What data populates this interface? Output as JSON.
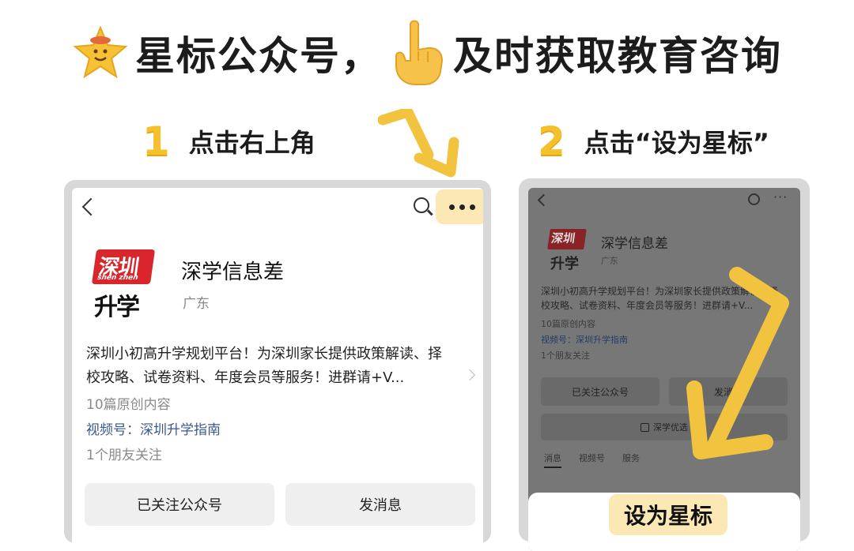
{
  "header": {
    "title": "星标公众号，",
    "title_tail": "及时获取教育咨询"
  },
  "step1": {
    "number": "1",
    "label": "点击右上角"
  },
  "step2": {
    "number": "2",
    "label": "点击“设为星标”"
  },
  "account": {
    "logo_text_top": "深圳",
    "logo_pinyin": "shen zhen",
    "logo_text_bottom": "升学",
    "name": "深学信息差",
    "region": "广东",
    "intro_line1": "深圳小初高升学规划平台！为深圳家长提供政策解读、择",
    "intro_line2": "校攻略、试卷资料、年度会员等服务！进群请+V...",
    "original_count": "10篇原创内容",
    "video_channel": "视频号：深圳升学指南",
    "friends_following": "1个朋友关注",
    "followed_button": "已关注公众号",
    "message_button": "发消息"
  },
  "phone2": {
    "more_glyph": "···",
    "logo_text_top": "深圳",
    "logo_text_bottom": "升学",
    "name": "深学信息差",
    "region": "广东",
    "intro_line1": "深圳小初高升学规划平台！为深圳家长提供政策解读、择",
    "intro_line2": "校攻略、试卷资料、年度会员等服务！进群请+V...",
    "original_count": "10篇原创内容",
    "video_channel": "视频号：深圳升学指南",
    "friends_following": "1个朋友关注",
    "followed_button": "已关注公众号",
    "message_button": "发消息",
    "shop_button": "深学优选",
    "tabs": [
      "消息",
      "视频号",
      "服务"
    ],
    "star_button": "设为星标"
  },
  "colors": {
    "accent_yellow": "#f5c02d",
    "highlight": "#fbe8b5",
    "brand_red": "#d8262c"
  }
}
